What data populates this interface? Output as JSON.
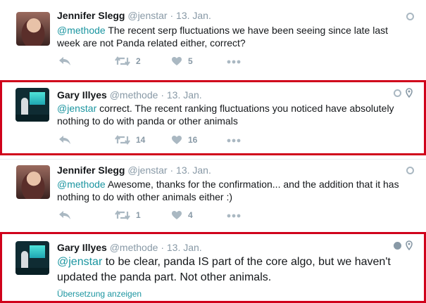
{
  "tweets": [
    {
      "name": "Jennifer Slegg",
      "handle": "@jenstar",
      "dot": "·",
      "date": "13. Jan.",
      "mention": "@methode",
      "text": " The recent serp fluctuations we have been seeing since late last week are not Panda related either, correct?",
      "retweets": "2",
      "likes": "5"
    },
    {
      "name": "Gary Illyes",
      "handle": "@methode",
      "dot": "·",
      "date": "13. Jan.",
      "mention": "@jenstar",
      "text": " correct. The recent ranking fluctuations you noticed have absolutely nothing to do with panda or other animals",
      "retweets": "14",
      "likes": "16"
    },
    {
      "name": "Jennifer Slegg",
      "handle": "@jenstar",
      "dot": "·",
      "date": "13. Jan.",
      "mention": "@methode",
      "text": " Awesome, thanks for the confirmation... and the addition that it has nothing to do with other animals either :)",
      "retweets": "1",
      "likes": "4"
    },
    {
      "name": "Gary Illyes",
      "handle": "@methode",
      "dot": "·",
      "date": "13. Jan.",
      "mention": "@jenstar",
      "text": " to be clear, panda IS part of the core algo, but we haven't updated the panda part. Not other animals.",
      "translate": "Übersetzung anzeigen"
    }
  ],
  "colors": {
    "highlight": "#d0021b",
    "link": "#1b95a0",
    "muted": "#8899a6"
  },
  "icons": [
    "reply-icon",
    "retweet-icon",
    "like-icon",
    "more-icon",
    "globe-icon",
    "location-pin-icon"
  ]
}
